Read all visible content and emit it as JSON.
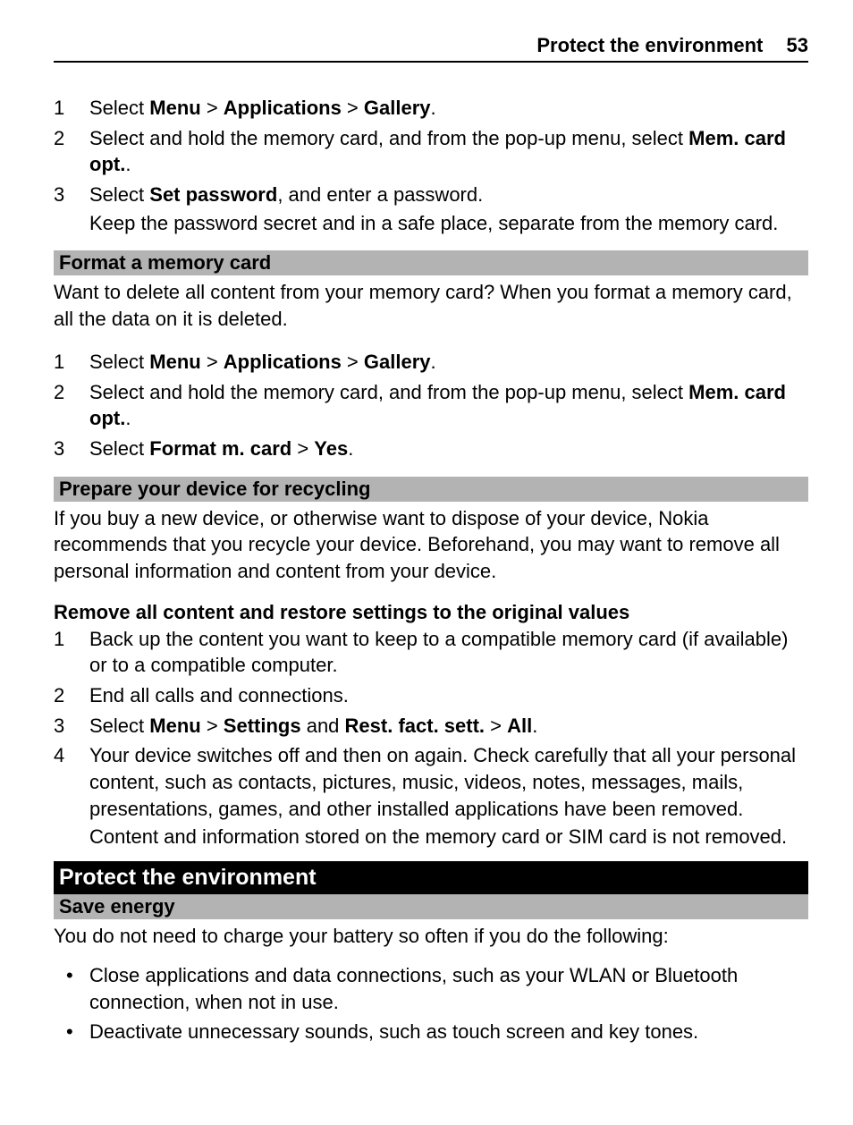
{
  "header": {
    "title": "Protect the environment",
    "page": "53"
  },
  "stepsA": [
    {
      "n": "1",
      "html": "Select <b>Menu</b> > <b>Applications</b> > <b>Gallery</b>."
    },
    {
      "n": "2",
      "html": "Select and hold the memory card, and from the pop-up menu, select <b>Mem. card opt.</b>."
    },
    {
      "n": "3",
      "html": "Select <b>Set password</b>, and enter a password.",
      "extra": "Keep the password secret and in a safe place, separate from the memory card."
    }
  ],
  "bar_format": "Format a memory card",
  "para_format": "Want to delete all content from your memory card? When you format a memory card, all the data on it is deleted.",
  "stepsB": [
    {
      "n": "1",
      "html": "Select <b>Menu</b> > <b>Applications</b> > <b>Gallery</b>."
    },
    {
      "n": "2",
      "html": "Select and hold the memory card, and from the pop-up menu, select <b>Mem. card opt.</b>."
    },
    {
      "n": "3",
      "html": "Select <b>Format m. card</b> > <b>Yes</b>."
    }
  ],
  "bar_recycle": "Prepare your device for recycling",
  "para_recycle": "If you buy a new device, or otherwise want to dispose of your device, Nokia recommends that you recycle your device. Beforehand, you may want to remove all personal information and content from your device.",
  "sub_remove": "Remove all content and restore settings to the original values",
  "stepsC": [
    {
      "n": "1",
      "html": "Back up the content you want to keep to a compatible memory card (if available) or to a compatible computer."
    },
    {
      "n": "2",
      "html": "End all calls and connections."
    },
    {
      "n": "3",
      "html": "Select <b>Menu</b> > <b>Settings</b> and <b>Rest. fact. sett.</b> > <b>All</b>."
    },
    {
      "n": "4",
      "html": "Your device switches off and then on again. Check carefully that all your personal content, such as contacts, pictures, music, videos, notes, messages, mails, presentations, games, and other installed applications have been removed.",
      "extra": "Content and information stored on the memory card or SIM card is not removed."
    }
  ],
  "black_protect": "Protect the environment",
  "bar_energy": "Save energy",
  "para_energy": "You do not need to charge your battery so often if you do the following:",
  "bullets": [
    "Close applications and data connections, such as your WLAN or Bluetooth connection, when not in use.",
    "Deactivate unnecessary sounds, such as touch screen and key tones."
  ]
}
